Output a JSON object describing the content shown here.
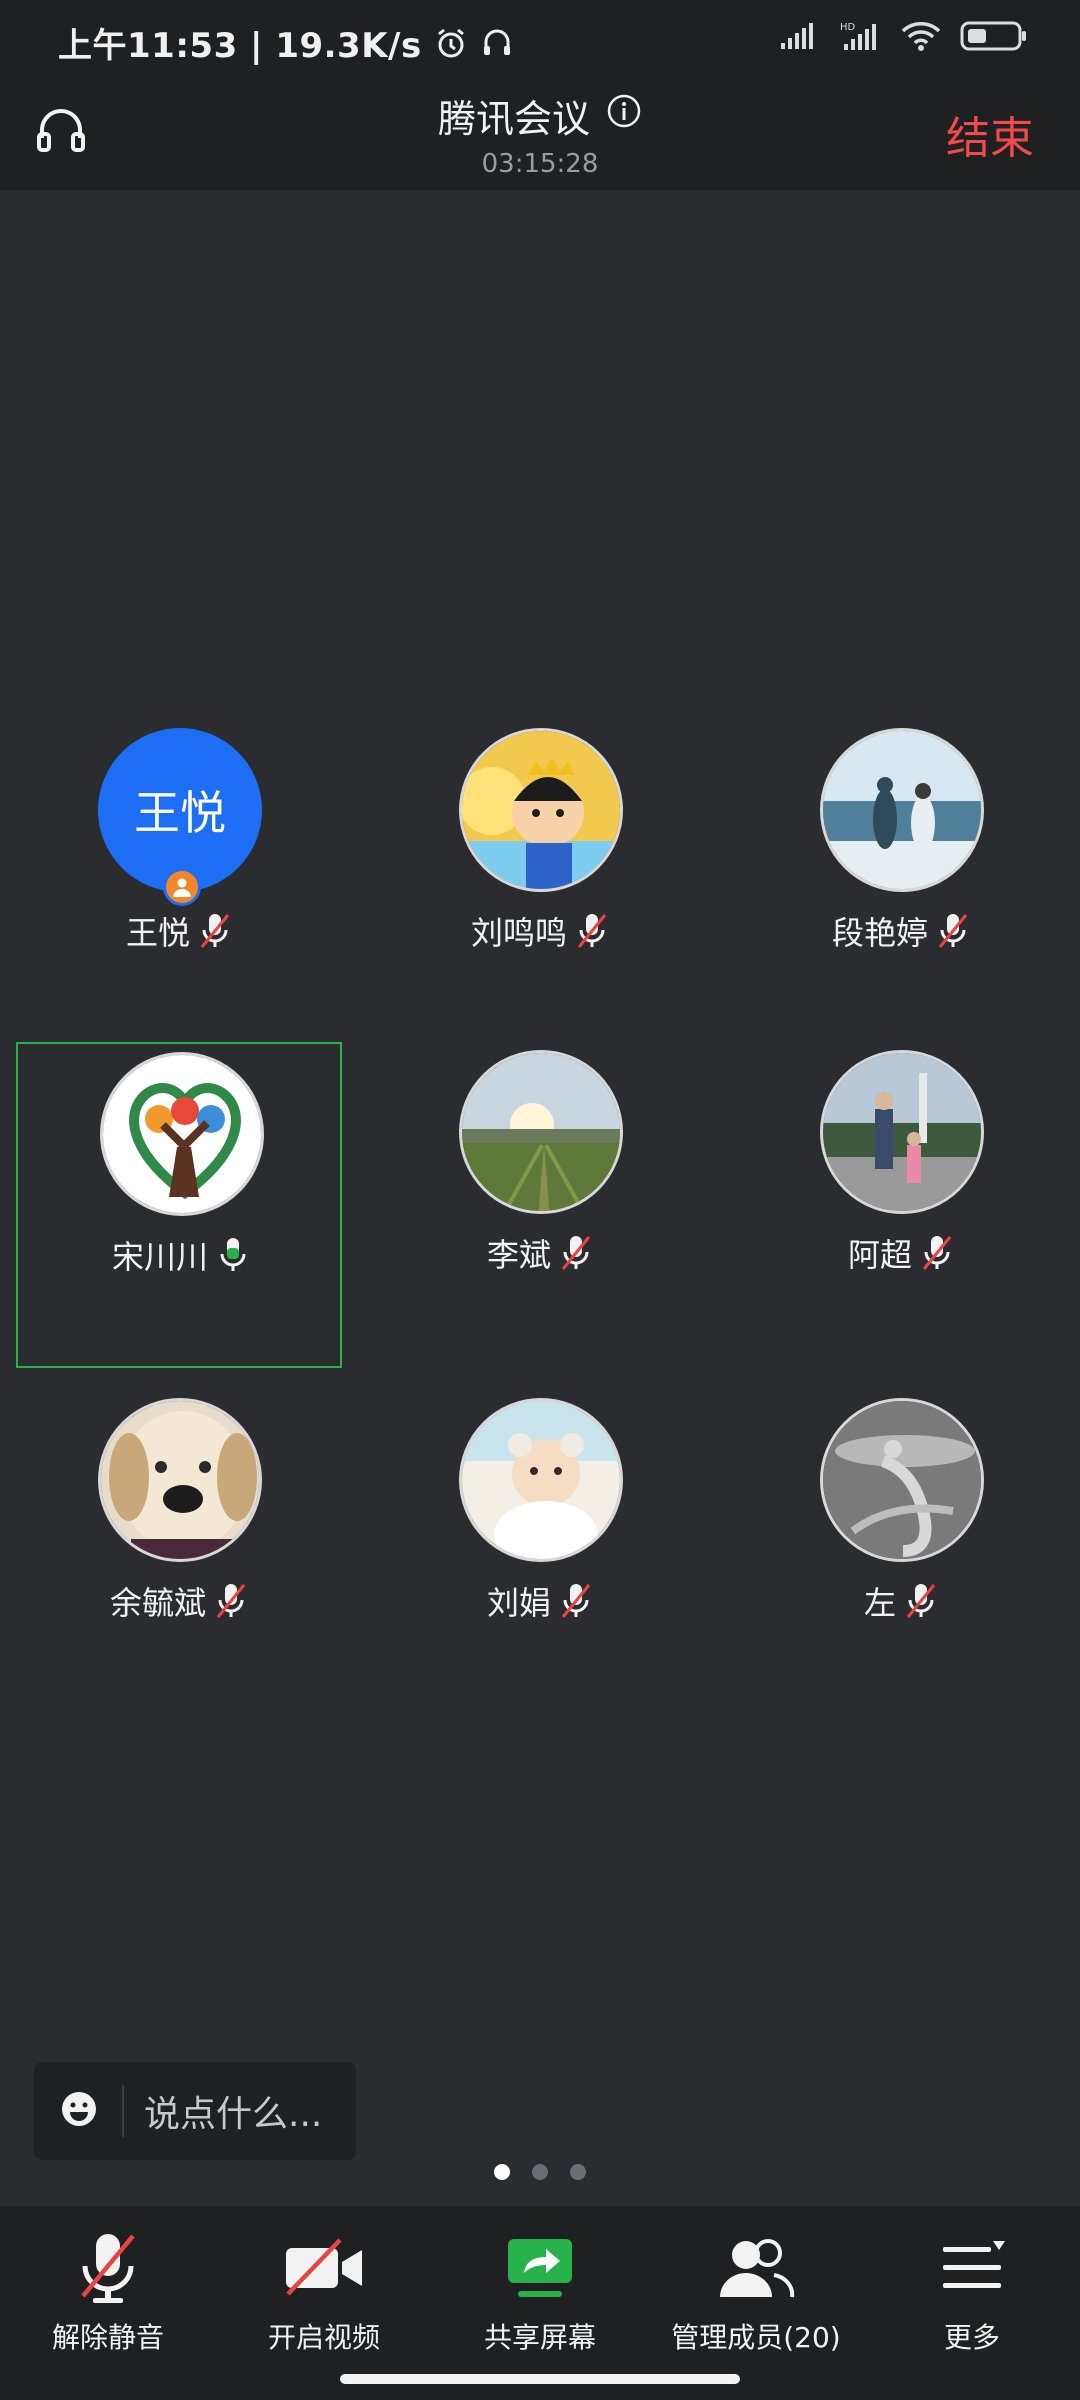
{
  "status_bar": {
    "time_speed": "上午11:53 | 19.3K/s"
  },
  "header": {
    "title": "腾讯会议",
    "elapsed": "03:15:28",
    "end_label": "结束"
  },
  "participants": [
    {
      "name": "王悦",
      "avatar_text": "王悦",
      "mic": "muted",
      "host": true
    },
    {
      "name": "刘鸣鸣",
      "mic": "muted"
    },
    {
      "name": "段艳婷",
      "mic": "muted"
    },
    {
      "name": "宋川川",
      "mic": "speaking",
      "active": true
    },
    {
      "name": "李斌",
      "mic": "muted"
    },
    {
      "name": "阿超",
      "mic": "muted"
    },
    {
      "name": "余毓斌",
      "mic": "muted"
    },
    {
      "name": "刘娟",
      "mic": "muted"
    },
    {
      "name": "左",
      "mic": "muted"
    }
  ],
  "chat": {
    "placeholder": "说点什么..."
  },
  "pager": {
    "pages": 3,
    "current": 1
  },
  "toolbar": {
    "unmute": "解除静音",
    "video": "开启视频",
    "share": "共享屏幕",
    "members": "管理成员(20)",
    "more": "更多"
  },
  "colors": {
    "accent_green": "#27b24a",
    "end_red": "#f04a4a",
    "avatar_blue": "#1e6ef5"
  }
}
